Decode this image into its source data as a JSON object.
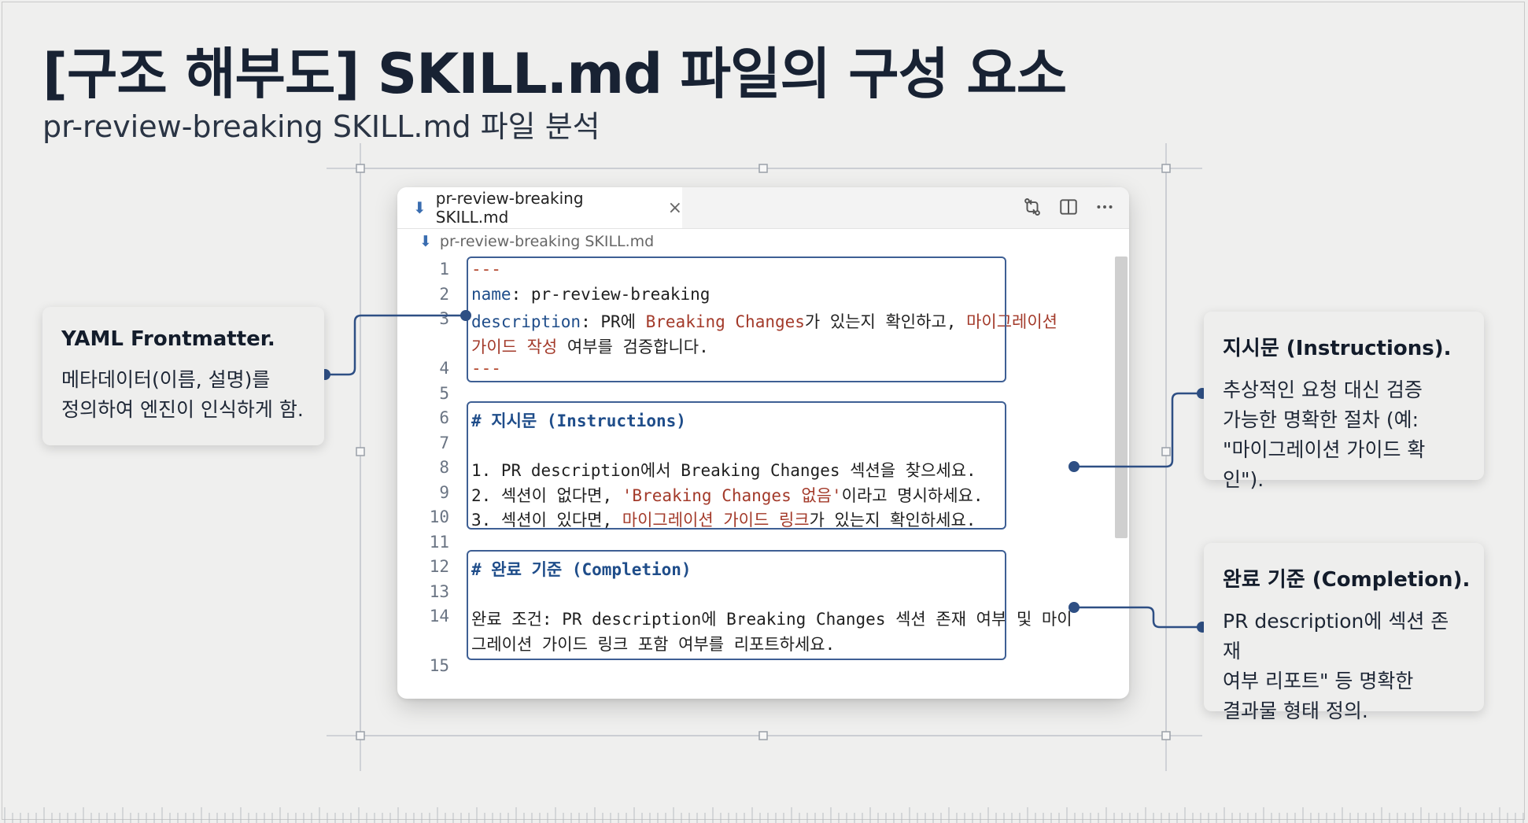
{
  "title": "[구조 해부도] SKILL.md 파일의 구성 요소",
  "subtitle": "pr-review-breaking SKILL.md 파일 분석",
  "editor": {
    "tab_label": "pr-review-breaking SKILL.md",
    "tab_close": "×",
    "breadcrumb": "pr-review-breaking SKILL.md",
    "action_icons": [
      "compare-changes-icon",
      "split-editor-icon",
      "more-actions-icon"
    ],
    "lines": [
      {
        "n": "1",
        "segments": [
          {
            "t": "---",
            "c": "dash"
          }
        ]
      },
      {
        "n": "2",
        "segments": [
          {
            "t": "name",
            "c": "k"
          },
          {
            "t": ": pr-review-breaking",
            "c": ""
          }
        ]
      },
      {
        "n": "3",
        "segments": [
          {
            "t": "description",
            "c": "k"
          },
          {
            "t": ": PR에 ",
            "c": ""
          },
          {
            "t": "Breaking Changes",
            "c": "r"
          },
          {
            "t": "가 있는지 확인하고, ",
            "c": ""
          },
          {
            "t": "마이그레이션",
            "c": "r"
          }
        ]
      },
      {
        "n": "",
        "segments": [
          {
            "t": "가이드 작성",
            "c": "r"
          },
          {
            "t": " 여부를 검증합니다.",
            "c": ""
          }
        ]
      },
      {
        "n": "4",
        "segments": [
          {
            "t": "---",
            "c": "dash"
          }
        ]
      },
      {
        "n": "5",
        "segments": []
      },
      {
        "n": "6",
        "segments": [
          {
            "t": "# 지시문 (Instructions)",
            "c": "h"
          }
        ]
      },
      {
        "n": "7",
        "segments": []
      },
      {
        "n": "8",
        "segments": [
          {
            "t": "1. PR description에서 Breaking Changes 섹션을 찾으세요.",
            "c": ""
          }
        ]
      },
      {
        "n": "9",
        "segments": [
          {
            "t": "2. 섹션이 없다면, ",
            "c": ""
          },
          {
            "t": "'Breaking Changes 없음'",
            "c": "r"
          },
          {
            "t": "이라고 명시하세요.",
            "c": ""
          }
        ]
      },
      {
        "n": "10",
        "segments": [
          {
            "t": "3. 섹션이 있다면, ",
            "c": ""
          },
          {
            "t": "마이그레이션 가이드 링크",
            "c": "r"
          },
          {
            "t": "가 있는지 확인하세요.",
            "c": ""
          }
        ]
      },
      {
        "n": "11",
        "segments": []
      },
      {
        "n": "12",
        "segments": [
          {
            "t": "# 완료 기준 (Completion)",
            "c": "h"
          }
        ]
      },
      {
        "n": "13",
        "segments": []
      },
      {
        "n": "14",
        "segments": [
          {
            "t": "완료 조건: PR description에 Breaking Changes 섹션 존재 여부 및 마이",
            "c": ""
          }
        ]
      },
      {
        "n": "",
        "segments": [
          {
            "t": "그레이션 가이드 링크 포함 여부를 리포트하세요.",
            "c": ""
          }
        ]
      },
      {
        "n": "15",
        "segments": []
      }
    ]
  },
  "callouts": {
    "yaml": {
      "title": "YAML Frontmatter.",
      "lines": [
        "메타데이터(이름, 설명)를",
        "정의하여 엔진이 인식하게 함."
      ]
    },
    "instructions": {
      "title": "지시문 (Instructions).",
      "lines": [
        "추상적인 요청 대신 검증",
        "가능한 명확한 절차 (예:",
        "\"마이그레이션 가이드 확인\")."
      ]
    },
    "completion": {
      "title": "완료 기준 (Completion).",
      "lines": [
        "PR description에 섹션 존재",
        "여부 리포트\" 등 명확한",
        "결과물 형태 정의."
      ]
    }
  },
  "colors": {
    "background": "#efefee",
    "accent": "#3e5f94",
    "keyword": "#1f4d8a",
    "highlight_text": "#a33a2a"
  }
}
